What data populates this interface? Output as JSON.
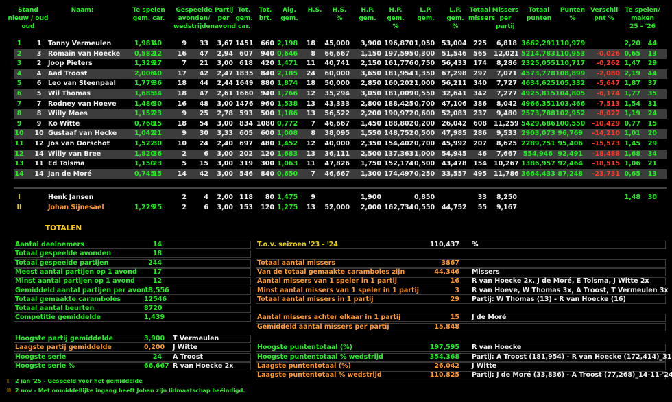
{
  "header": [
    {
      "id": "stand",
      "lines": [
        "Stand",
        "nieuw / oud",
        "oud"
      ]
    },
    {
      "id": "naam",
      "lines": [
        "Naam:"
      ]
    },
    {
      "id": "tespelen",
      "lines": [
        "Te spelen",
        "gem.      car."
      ]
    },
    {
      "id": "gespeelde",
      "lines": [
        "Gespeelde",
        "avonden/",
        "wedstrijden"
      ]
    },
    {
      "id": "partij",
      "lines": [
        "Partij",
        "per",
        "avond"
      ]
    },
    {
      "id": "totgem",
      "lines": [
        "Tot.",
        "gem.",
        "car."
      ]
    },
    {
      "id": "totbrt",
      "lines": [
        "Tot.",
        "brt."
      ]
    },
    {
      "id": "alg",
      "lines": [
        "Alg.",
        "gem."
      ]
    },
    {
      "id": "hs",
      "lines": [
        "H.S."
      ]
    },
    {
      "id": "hsp",
      "lines": [
        "H.S.",
        "%"
      ]
    },
    {
      "id": "hp",
      "lines": [
        "H.P.",
        "gem."
      ]
    },
    {
      "id": "hpp",
      "lines": [
        "H.P.",
        "gem.",
        "%"
      ]
    },
    {
      "id": "lp",
      "lines": [
        "L.P.",
        "gem."
      ]
    },
    {
      "id": "lpp",
      "lines": [
        "L.P.",
        "gem.",
        "%"
      ]
    },
    {
      "id": "totmis",
      "lines": [
        "Totaal",
        "missers"
      ]
    },
    {
      "id": "mispp",
      "lines": [
        "Missers",
        "per",
        "partij"
      ]
    },
    {
      "id": "totpunt",
      "lines": [
        "Totaal",
        "punten"
      ]
    },
    {
      "id": "puntp",
      "lines": [
        "Punten",
        "%"
      ]
    },
    {
      "id": "verschil",
      "lines": [
        "Verschil",
        "pnt %"
      ]
    },
    {
      "id": "tespelen2",
      "lines": [
        "Te spelen/",
        "maken",
        "25 - '26"
      ]
    }
  ],
  "rows": [
    {
      "n": "1",
      "o": "1",
      "name": "Tonny Vermeulen",
      "gem": "1,981",
      "car": "40",
      "av": "9",
      "wd": "33",
      "ppa": "3,67",
      "tg": "1451",
      "tb": "660",
      "alg": "2,198",
      "hs": "18",
      "hsp": "45,000",
      "hp": "3,900",
      "hpp": "196,870",
      "lp": "1,050",
      "lpp": "53,004",
      "tm": "225",
      "mpp": "6,818",
      "tp": "3662,291",
      "pp": "110,979",
      "vs": "",
      "ts": "2,20",
      "tc": "44"
    },
    {
      "n": "2",
      "o": "3",
      "name": "Romain van Hoecke",
      "gem": "0,582",
      "car": "12",
      "av": "16",
      "wd": "47",
      "ppa": "2,94",
      "tg": "607",
      "tb": "940",
      "alg": "0,646",
      "hs": "8",
      "hsp": "66,667",
      "hp": "1,150",
      "hpp": "197,595",
      "lp": "0,300",
      "lpp": "51,546",
      "tm": "565",
      "mpp": "12,021",
      "tp": "5214,783",
      "pp": "110,953",
      "vs": "-0,026",
      "ts": "0,65",
      "tc": "13"
    },
    {
      "n": "3",
      "o": "2",
      "name": "Joop Pieters",
      "gem": "1,329",
      "car": "27",
      "av": "7",
      "wd": "21",
      "ppa": "3,00",
      "tg": "618",
      "tb": "420",
      "alg": "1,471",
      "hs": "11",
      "hsp": "40,741",
      "hp": "2,150",
      "hpp": "161,776",
      "lp": "0,750",
      "lpp": "56,433",
      "tm": "174",
      "mpp": "8,286",
      "tp": "2325,055",
      "pp": "110,717",
      "vs": "-0,262",
      "ts": "1,47",
      "tc": "29"
    },
    {
      "n": "4",
      "o": "4",
      "name": "Aad Troost",
      "gem": "2,006",
      "car": "40",
      "av": "17",
      "wd": "42",
      "ppa": "2,47",
      "tg": "1835",
      "tb": "840",
      "alg": "2,185",
      "hs": "24",
      "hsp": "60,000",
      "hp": "3,650",
      "hpp": "181,954",
      "lp": "1,350",
      "lpp": "67,298",
      "tm": "297",
      "mpp": "7,071",
      "tp": "4573,778",
      "pp": "108,899",
      "vs": "-2,080",
      "ts": "2,19",
      "tc": "44"
    },
    {
      "n": "5",
      "o": "6",
      "name": "Leo van Steenpaal",
      "gem": "1,779",
      "car": "36",
      "av": "18",
      "wd": "44",
      "ppa": "2,44",
      "tg": "1649",
      "tb": "880",
      "alg": "1,874",
      "hs": "18",
      "hsp": "50,000",
      "hp": "2,850",
      "hpp": "160,202",
      "lp": "1,000",
      "lpp": "56,211",
      "tm": "340",
      "mpp": "7,727",
      "tp": "4634,625",
      "pp": "105,332",
      "vs": "-5,647",
      "ts": "1,87",
      "tc": "37"
    },
    {
      "n": "6",
      "o": "5",
      "name": "Wil Thomas",
      "gem": "1,685",
      "car": "34",
      "av": "18",
      "wd": "47",
      "ppa": "2,61",
      "tg": "1660",
      "tb": "940",
      "alg": "1,766",
      "hs": "12",
      "hsp": "35,294",
      "hp": "3,050",
      "hpp": "181,009",
      "lp": "0,550",
      "lpp": "32,641",
      "tm": "342",
      "mpp": "7,277",
      "tp": "4925,815",
      "pp": "104,805",
      "vs": "-6,174",
      "ts": "1,77",
      "tc": "35"
    },
    {
      "n": "7",
      "o": "7",
      "name": "Rodney van Hoeve",
      "gem": "1,486",
      "car": "30",
      "av": "16",
      "wd": "48",
      "ppa": "3,00",
      "tg": "1476",
      "tb": "960",
      "alg": "1,538",
      "hs": "13",
      "hsp": "43,333",
      "hp": "2,800",
      "hpp": "188,425",
      "lp": "0,700",
      "lpp": "47,106",
      "tm": "386",
      "mpp": "8,042",
      "tp": "4966,351",
      "pp": "103,466",
      "vs": "-7,513",
      "ts": "1,54",
      "tc": "31"
    },
    {
      "n": "8",
      "o": "8",
      "name": "Willy Moes",
      "gem": "1,152",
      "car": "23",
      "av": "9",
      "wd": "25",
      "ppa": "2,78",
      "tg": "593",
      "tb": "500",
      "alg": "1,186",
      "hs": "13",
      "hsp": "56,522",
      "hp": "2,200",
      "hpp": "190,972",
      "lp": "0,600",
      "lpp": "52,083",
      "tm": "237",
      "mpp": "9,480",
      "tp": "2573,788",
      "pp": "102,952",
      "vs": "-8,027",
      "ts": "1,19",
      "tc": "24"
    },
    {
      "n": "9",
      "o": "9",
      "name": "Ko Witte",
      "gem": "0,768",
      "car": "15",
      "av": "18",
      "wd": "54",
      "ppa": "3,00",
      "tg": "834",
      "tb": "1080",
      "alg": "0,772",
      "hs": "7",
      "hsp": "46,667",
      "hp": "1,450",
      "hpp": "188,802",
      "lp": "0,200",
      "lpp": "26,042",
      "tm": "608",
      "mpp": "11,259",
      "tp": "5429,686",
      "pp": "100,550",
      "vs": "-10,429",
      "ts": "0,77",
      "tc": "15"
    },
    {
      "n": "10",
      "o": "10",
      "name": "Gustaaf van Hecke",
      "gem": "1,042",
      "car": "21",
      "av": "9",
      "wd": "30",
      "ppa": "3,33",
      "tg": "605",
      "tb": "600",
      "alg": "1,008",
      "hs": "8",
      "hsp": "38,095",
      "hp": "1,550",
      "hpp": "148,752",
      "lp": "0,500",
      "lpp": "47,985",
      "tm": "286",
      "mpp": "9,533",
      "tp": "2903,073",
      "pp": "96,769",
      "vs": "-14,210",
      "ts": "1,01",
      "tc": "20"
    },
    {
      "n": "11",
      "o": "12",
      "name": "Jos van Oorschot",
      "gem": "1,522",
      "car": "30",
      "av": "10",
      "wd": "24",
      "ppa": "2,40",
      "tg": "697",
      "tb": "480",
      "alg": "1,452",
      "hs": "12",
      "hsp": "40,000",
      "hp": "2,350",
      "hpp": "154,402",
      "lp": "0,700",
      "lpp": "45,992",
      "tm": "207",
      "mpp": "8,625",
      "tp": "2289,751",
      "pp": "95,406",
      "vs": "-15,573",
      "ts": "1,45",
      "tc": "29"
    },
    {
      "n": "12",
      "o": "14",
      "name": "Willy van Bree",
      "gem": "1,820",
      "car": "36",
      "av": "2",
      "wd": "6",
      "ppa": "3,00",
      "tg": "202",
      "tb": "120",
      "alg": "1,683",
      "hs": "13",
      "hsp": "36,111",
      "hp": "2,500",
      "hpp": "137,363",
      "lp": "1,000",
      "lpp": "54,945",
      "tm": "46",
      "mpp": "7,667",
      "tp": "554,946",
      "pp": "92,491",
      "vs": "-18,488",
      "ts": "1,68",
      "tc": "34"
    },
    {
      "n": "13",
      "o": "11",
      "name": "Ed Tolsma",
      "gem": "1,150",
      "car": "23",
      "av": "5",
      "wd": "15",
      "ppa": "3,00",
      "tg": "319",
      "tb": "300",
      "alg": "1,063",
      "hs": "11",
      "hsp": "47,826",
      "hp": "1,750",
      "hpp": "152,174",
      "lp": "0,500",
      "lpp": "43,478",
      "tm": "154",
      "mpp": "10,267",
      "tp": "1386,957",
      "pp": "92,464",
      "vs": "-18,515",
      "ts": "1,06",
      "tc": "21"
    },
    {
      "n": "14",
      "o": "14",
      "name": "Jan de Moré",
      "gem": "0,745",
      "car": "15",
      "av": "14",
      "wd": "42",
      "ppa": "3,00",
      "tg": "546",
      "tb": "840",
      "alg": "0,650",
      "hs": "7",
      "hsp": "46,667",
      "hp": "1,300",
      "hpp": "174,497",
      "lp": "0,250",
      "lpp": "33,557",
      "tm": "495",
      "mpp": "11,786",
      "tp": "3664,433",
      "pp": "87,248",
      "vs": "-23,731",
      "ts": "0,65",
      "tc": "13"
    }
  ],
  "extra_rows": [
    {
      "n": "I",
      "name": "Henk Jansen",
      "gem": "",
      "car": "",
      "av": "2",
      "wd": "4",
      "ppa": "2,00",
      "tg": "118",
      "tb": "80",
      "alg": "1,475",
      "hs": "9",
      "hsp": "",
      "hp": "1,900",
      "hpp": "",
      "lp": "0,850",
      "lpp": "",
      "tm": "33",
      "mpp": "8,250",
      "ts": "1,48",
      "tc": "30"
    },
    {
      "n": "II",
      "name": "Johan Sijnesael",
      "gem": "1,229",
      "car": "25",
      "av": "2",
      "wd": "6",
      "ppa": "3,00",
      "tg": "153",
      "tb": "120",
      "alg": "1,275",
      "hs": "13",
      "hsp": "52,000",
      "hp": "2,000",
      "hpp": "162,734",
      "lp": "0,550",
      "lpp": "44,752",
      "tm": "55",
      "mpp": "9,167",
      "ts": "",
      "tc": ""
    }
  ],
  "totals_title": "TOTALEN",
  "totals_left": [
    {
      "label": "Aantal deelnemers",
      "value": "14",
      "extra": "",
      "color": "g"
    },
    {
      "label": "Totaal gespeelde avonden",
      "value": "18",
      "extra": "",
      "color": "g"
    },
    {
      "label": "Totaal gespeelde partijen",
      "value": "244",
      "extra": "",
      "color": "g"
    },
    {
      "label": "Meest aantal partijen op 1 avond",
      "value": "17",
      "extra": "",
      "color": "g"
    },
    {
      "label": "Minst aantal partijen op 1 avond",
      "value": "12",
      "extra": "",
      "color": "g"
    },
    {
      "label": "Gemiddeld aantal partijen per avond",
      "value": "13,556",
      "extra": "",
      "color": "g"
    },
    {
      "label": "Totaal gemaakte caramboles",
      "value": "12546",
      "extra": "",
      "color": "g"
    },
    {
      "label": "Totaal aantal beurten",
      "value": "8720",
      "extra": "",
      "color": "g"
    },
    {
      "label": "Competitie gemiddelde",
      "value": "1,439",
      "extra": "",
      "color": "g"
    },
    {
      "label": "Hoogste partij gemiddelde",
      "value": "3,900",
      "extra": "T Vermeulen",
      "color": "g"
    },
    {
      "label": "Laagste partij gemiddelde",
      "value": "0,200",
      "extra": "J Witte",
      "color": "o"
    },
    {
      "label": "Hoogste serie",
      "value": "24",
      "extra": "A Troost",
      "color": "g"
    },
    {
      "label": "Hoogste serie %",
      "value": "66,667",
      "extra": "R van Hoecke 2x",
      "color": "g"
    }
  ],
  "totals_right": [
    {
      "label": "T.o.v. seizoen '23 - '24",
      "value": "110,437",
      "extra": "%",
      "color": "y"
    },
    {
      "label": "Totaal aantal missers",
      "value": "3867",
      "extra": "",
      "color": "o"
    },
    {
      "label": "Van de totaal gemaakte caramboles zijn",
      "value": "44,346",
      "extra": "Missers",
      "color": "o"
    },
    {
      "label": "Aantal missers van 1 speler in 1 partij",
      "value": "16",
      "extra": "R van Hoecke 2x, J de Moré, E Tolsma, J Witte 2x",
      "color": "o"
    },
    {
      "label": "Minst aantal missers van 1 speler in 1 partij",
      "value": "3",
      "extra": "R van Hoeve, W Thomas 3x, A Troost, T Vermeulen 3x",
      "color": "o"
    },
    {
      "label": "Totaal aantal missers in 1 partij",
      "value": "29",
      "extra": "Partij: W Thomas (13) - R van Hoecke (16)",
      "color": "o"
    },
    {
      "label": "Aantal missers achter elkaar in 1 partij",
      "value": "15",
      "extra": "J de Moré",
      "color": "o"
    },
    {
      "label": "Gemiddeld aantal missers per partij",
      "value": "15,848",
      "extra": "",
      "color": "o"
    },
    {
      "label": "Hoogste puntentotaal (%)",
      "value": "197,595",
      "extra": "R van Hoecke",
      "color": "g"
    },
    {
      "label": "Hoogste puntentotaal % wedstrijd",
      "value": "354,368",
      "extra": "Partij: A Troost (181,954) - R van Hoecke (172,414)_31-10-'24",
      "color": "g"
    },
    {
      "label": "Laagste puntentotaal (%)",
      "value": "26,042",
      "extra": "J Witte",
      "color": "o"
    },
    {
      "label": "Laagste puntentotaal % wedstrijd",
      "value": "110,825",
      "extra": "Partij: J de Moré (33,836) - A Troost (77,268)_14-11-'24",
      "color": "o"
    }
  ],
  "footnotes": [
    {
      "mark": "I",
      "text": "2 jan '25 - Gespeeld voor het gemiddelde"
    },
    {
      "mark": "II",
      "text": "2 nov - Met onmiddellijke ingang heeft Johan zijn lidmaatschap beëindigd."
    }
  ]
}
